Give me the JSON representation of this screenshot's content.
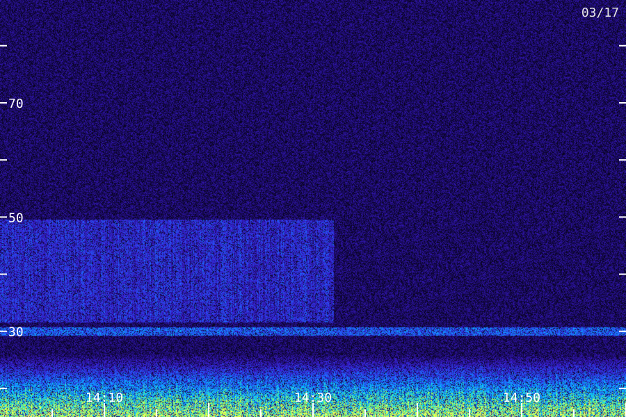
{
  "date_label": "03/17",
  "chart_data": {
    "type": "heatmap",
    "title": "",
    "xlabel": "",
    "ylabel": "",
    "y_ticks": [
      20,
      30,
      40,
      50,
      60,
      70,
      80
    ],
    "y_tick_labels": [
      {
        "value": 30,
        "label": "30"
      },
      {
        "value": 50,
        "label": "50"
      },
      {
        "value": 70,
        "label": "70"
      }
    ],
    "ylim": [
      15,
      88
    ],
    "x_tick_labels": [
      {
        "time": "14:10",
        "label": "14:10"
      },
      {
        "time": "14:30",
        "label": "14:30"
      },
      {
        "time": "14:50",
        "label": "14:50"
      }
    ],
    "x_major_ticks": [
      "14:10",
      "14:20",
      "14:30",
      "14:40",
      "14:50",
      "15:00"
    ],
    "x_minor_ticks": [
      "14:05",
      "14:15",
      "14:25",
      "14:35",
      "14:45",
      "14:55"
    ],
    "xlim": [
      "14:00",
      "15:00"
    ],
    "features": [
      {
        "name": "broadband noise",
        "y_range": [
          34,
          46
        ],
        "x_range": [
          "14:00",
          "14:32"
        ]
      },
      {
        "name": "narrow band",
        "y_range": [
          29.5,
          30.5
        ],
        "x_range": [
          "14:00",
          "15:00"
        ]
      },
      {
        "name": "strong low-band activity",
        "y_range": [
          15,
          23
        ],
        "x_range": [
          "14:00",
          "15:00"
        ]
      }
    ],
    "colormap": [
      "#000000",
      "#1a0a60",
      "#3a1cd0",
      "#1a6cff",
      "#00d8ff",
      "#a8ff40",
      "#ffff60"
    ]
  }
}
